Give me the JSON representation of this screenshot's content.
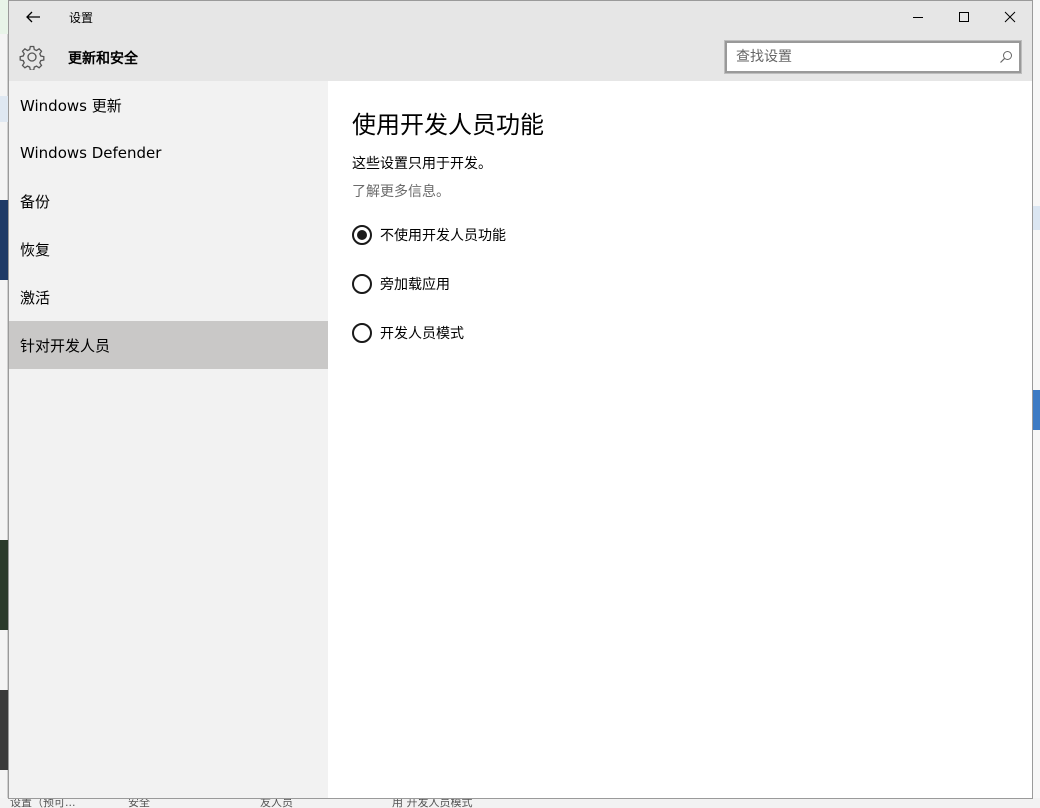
{
  "window": {
    "title": "设置"
  },
  "header": {
    "title": "更新和安全",
    "icon": "gear-icon",
    "search_placeholder": "查找设置"
  },
  "sidebar": {
    "items": [
      {
        "label": "Windows 更新",
        "active": false
      },
      {
        "label": "Windows Defender",
        "active": false
      },
      {
        "label": "备份",
        "active": false
      },
      {
        "label": "恢复",
        "active": false
      },
      {
        "label": "激活",
        "active": false
      },
      {
        "label": "针对开发人员",
        "active": true
      }
    ]
  },
  "content": {
    "title": "使用开发人员功能",
    "description": "这些设置只用于开发。",
    "link": "了解更多信息。",
    "options": [
      {
        "label": "不使用开发人员功能",
        "selected": true
      },
      {
        "label": "旁加载应用",
        "selected": false
      },
      {
        "label": "开发人员模式",
        "selected": false
      }
    ]
  },
  "background": {
    "bottom_fragments": [
      "设置（预可...",
      "安全",
      "友人员",
      "用 开发人员模式"
    ]
  },
  "colors": {
    "titlebar": "#e6e6e6",
    "sidebar": "#f2f2f2",
    "sidebar_active": "#c9c8c7",
    "content": "#ffffff",
    "link": "#6b6b6b"
  }
}
